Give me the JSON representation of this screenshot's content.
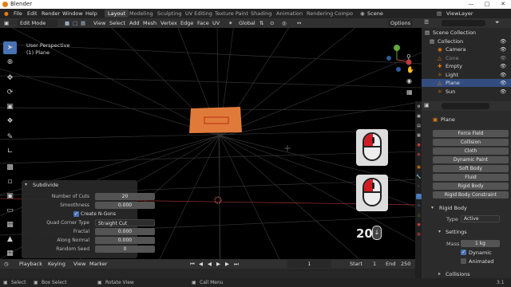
{
  "titlebar": {
    "title": "Blender"
  },
  "menubar": {
    "menus": [
      "File",
      "Edit",
      "Render",
      "Window",
      "Help"
    ],
    "workspaces": [
      "Layout",
      "Modeling",
      "Sculpting",
      "UV Editing",
      "Texture Paint",
      "Shading",
      "Animation",
      "Rendering",
      "Compo"
    ],
    "scene_label": "Scene",
    "viewlayer_label": "ViewLayer"
  },
  "header": {
    "mode": "Edit Mode",
    "menus": [
      "View",
      "Select",
      "Add",
      "Mesh",
      "Vertex",
      "Edge",
      "Face",
      "UV"
    ],
    "orientation": "Global",
    "options": "Options"
  },
  "viewport": {
    "view_name": "User Perspective",
    "object_label": "(1) Plane",
    "counter": "20"
  },
  "redo_panel": {
    "title": "Subdivide",
    "rows": [
      {
        "label": "Number of Cuts",
        "value": "20"
      },
      {
        "label": "Smoothness",
        "value": "0.000"
      }
    ],
    "checkbox_label": "Create N-Gons",
    "corner_label": "Quad Corner Type",
    "corner_value": "Straight Cut",
    "rows2": [
      {
        "label": "Fractal",
        "value": "0.000"
      },
      {
        "label": "Along Normal",
        "value": "0.000"
      },
      {
        "label": "Random Seed",
        "value": "0"
      }
    ]
  },
  "timeline": {
    "playback": "Playback",
    "keying": "Keying",
    "view": "View",
    "marker": "Marker",
    "current_frame": "1",
    "start_label": "Start",
    "start": "1",
    "end_label": "End",
    "end": "250"
  },
  "statusbar": {
    "select": "Select",
    "box_select": "Box Select",
    "rotate": "Rotate View",
    "call_menu": "Call Menu",
    "version": "3.1"
  },
  "outliner": {
    "search_placeholder": "",
    "items": [
      {
        "name": "Scene Collection",
        "indent": 0,
        "selected": false
      },
      {
        "name": "Collection",
        "indent": 1,
        "selected": false
      },
      {
        "name": "Camera",
        "indent": 2,
        "selected": false
      },
      {
        "name": "Cone",
        "indent": 2,
        "selected": false
      },
      {
        "name": "Empty",
        "indent": 2,
        "selected": false
      },
      {
        "name": "Light",
        "indent": 2,
        "selected": false
      },
      {
        "name": "Plane",
        "indent": 2,
        "selected": true
      },
      {
        "name": "Sun",
        "indent": 2,
        "selected": false
      }
    ]
  },
  "properties": {
    "object_name": "Plane",
    "buttons": [
      "Force Field",
      "Collision",
      "Cloth",
      "Dynamic Paint",
      "Soft Body",
      "Fluid",
      "Rigid Body",
      "Rigid Body Constraint"
    ],
    "rigid_body_title": "Rigid Body",
    "type_label": "Type",
    "type_value": "Active",
    "settings_title": "Settings",
    "mass_label": "Mass",
    "mass_value": "1 kg",
    "dynamic_label": "Dynamic",
    "animated_label": "Animated",
    "collisions_title": "Collisions"
  },
  "colors": {
    "accent": "#4772b3",
    "selection": "#e87d0d",
    "plane": "#e07a3a",
    "mouse_red": "#d21c24"
  }
}
